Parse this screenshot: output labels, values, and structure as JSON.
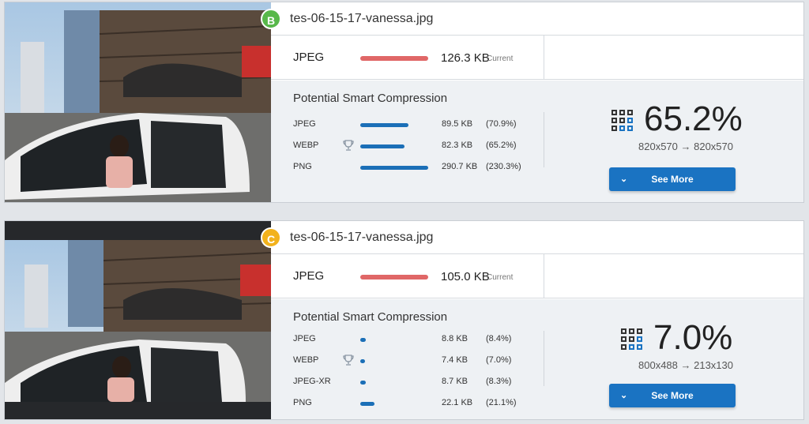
{
  "cards": [
    {
      "badge": "B",
      "filename": "tes-06-15-17-vanessa.jpg",
      "current": {
        "format": "JPEG",
        "size": "126.3 KB",
        "tag": "Current"
      },
      "compression_title": "Potential Smart Compression",
      "formats": [
        {
          "name": "JPEG",
          "size": "89.5 KB",
          "pct": "(70.9%)",
          "ratio": 0.709
        },
        {
          "name": "WEBP",
          "size": "82.3 KB",
          "pct": "(65.2%)",
          "ratio": 0.652,
          "winner": true
        },
        {
          "name": "PNG",
          "size": "290.7 KB",
          "pct": "(230.3%)",
          "ratio": 1.0
        }
      ],
      "result": {
        "percent": "65.2%",
        "dimensions": "820x570 → 820x570"
      },
      "see_more": "See More"
    },
    {
      "badge": "C",
      "filename": "tes-06-15-17-vanessa.jpg",
      "current": {
        "format": "JPEG",
        "size": "105.0 KB",
        "tag": "Current"
      },
      "compression_title": "Potential Smart Compression",
      "formats": [
        {
          "name": "JPEG",
          "size": "8.8 KB",
          "pct": "(8.4%)",
          "ratio": 0.084
        },
        {
          "name": "WEBP",
          "size": "7.4 KB",
          "pct": "(7.0%)",
          "ratio": 0.07,
          "winner": true
        },
        {
          "name": "JPEG-XR",
          "size": "8.7 KB",
          "pct": "(8.3%)",
          "ratio": 0.083
        },
        {
          "name": "PNG",
          "size": "22.1 KB",
          "pct": "(21.1%)",
          "ratio": 0.211
        }
      ],
      "result": {
        "percent": "7.0%",
        "dimensions": "800x488 → 213x130"
      },
      "see_more": "See More"
    }
  ],
  "colors": {
    "current_bar": "#e06767",
    "format_bar": "#1b6fb7",
    "button": "#1a73c2",
    "badge_b": "#58b84a",
    "badge_c": "#f2b21c"
  }
}
